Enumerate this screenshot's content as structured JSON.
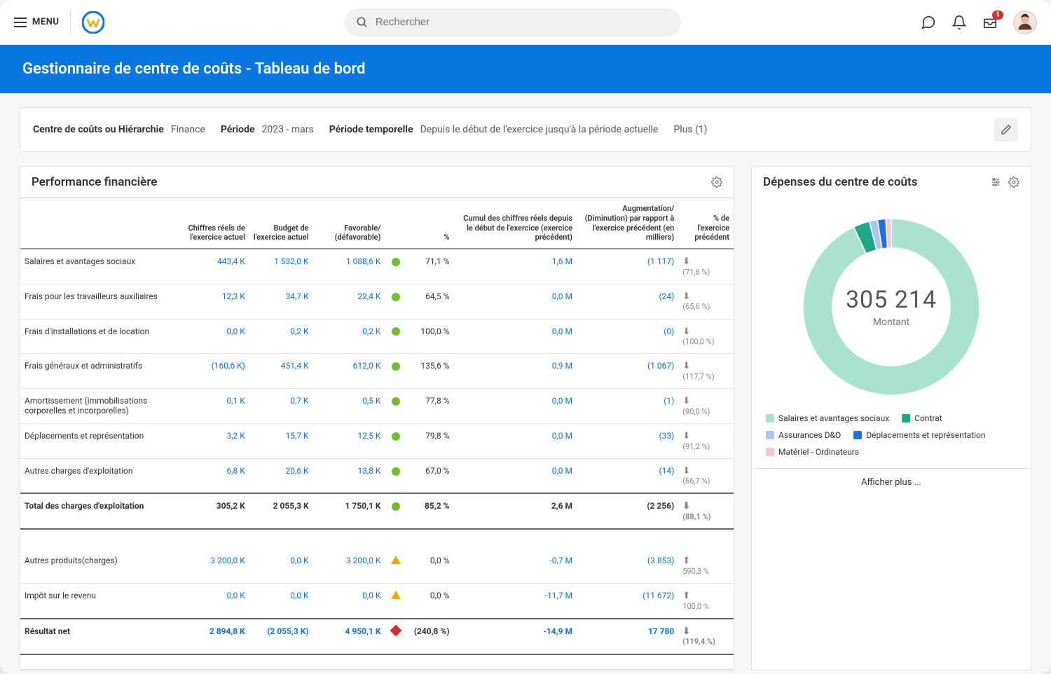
{
  "topbar": {
    "menu_label": "MENU",
    "search_placeholder": "Rechercher",
    "inbox_badge": "1"
  },
  "banner_title": "Gestionnaire de centre de coûts - Tableau de bord",
  "filters": {
    "cc_label": "Centre de coûts ou Hiérarchie",
    "cc_value": "Finance",
    "period_label": "Période",
    "period_value": "2023 - mars",
    "timeframe_label": "Période temporelle",
    "timeframe_value": "Depuis le début de l'exercice jusqu'à la période actuelle",
    "more_label": "Plus (1)"
  },
  "perf": {
    "title": "Performance financière",
    "headers": {
      "name": "",
      "actual": "Chiffres réels de l'exercice actuel",
      "budget": "Budget de l'exercice actuel",
      "fav": "Favorable/ (défavorable)",
      "pct": "%",
      "prior_ytd": "Cumul des chiffres réels depuis le début de l'exercice (exercice précédent)",
      "delta": "Augmentation/ (Diminution) par rapport à l'exercice précédent (en milliers)",
      "prior_pct": "% de l'exercice précédent"
    },
    "rows": [
      {
        "name": "Salaires et avantages sociaux",
        "actual": "443,4 K",
        "budget": "1 532,0 K",
        "fav": "1 088,6 K",
        "ind": "green",
        "pct": "71,1 %",
        "prior": "1,6 M",
        "delta": "(1 117)",
        "arr": "down",
        "ppct": "(71,6 %)"
      },
      {
        "name": "Frais pour les travailleurs auxiliaires",
        "actual": "12,3 K",
        "budget": "34,7 K",
        "fav": "22,4 K",
        "ind": "green",
        "pct": "64,5 %",
        "prior": "0,0 M",
        "delta": "(24)",
        "arr": "down",
        "ppct": "(65,6 %)"
      },
      {
        "name": "Frais d'installations et de location",
        "actual": "0,0 K",
        "budget": "0,2 K",
        "fav": "0,2 K",
        "ind": "green",
        "pct": "100,0 %",
        "prior": "0,0 M",
        "delta": "(0)",
        "arr": "down",
        "ppct": "(100,0 %)"
      },
      {
        "name": "Frais généraux et administratifs",
        "actual": "(160,6 K)",
        "budget": "451,4 K",
        "fav": "612,0 K",
        "ind": "green",
        "pct": "135,6 %",
        "prior": "0,9 M",
        "delta": "(1 067)",
        "arr": "down",
        "ppct": "(117,7 %)"
      },
      {
        "name": "Amortissement (immobilisations corporelles et incorporelles)",
        "actual": "0,1 K",
        "budget": "0,7 K",
        "fav": "0,5 K",
        "ind": "green",
        "pct": "77,8 %",
        "prior": "0,0 M",
        "delta": "(1)",
        "arr": "down",
        "ppct": "(90,0 %)"
      },
      {
        "name": "Déplacements et représentation",
        "actual": "3,2 K",
        "budget": "15,7 K",
        "fav": "12,5 K",
        "ind": "green",
        "pct": "79,8 %",
        "prior": "0,0 M",
        "delta": "(33)",
        "arr": "down",
        "ppct": "(91,2 %)"
      },
      {
        "name": "Autres charges d'exploitation",
        "actual": "6,8 K",
        "budget": "20,6 K",
        "fav": "13,8 K",
        "ind": "green",
        "pct": "67,0 %",
        "prior": "0,0 M",
        "delta": "(14)",
        "arr": "down",
        "ppct": "(66,7 %)"
      }
    ],
    "total": {
      "name": "Total des charges d'exploitation",
      "actual": "305,2 K",
      "budget": "2 055,3 K",
      "fav": "1 750,1 K",
      "ind": "green",
      "pct": "85,2 %",
      "prior": "2,6 M",
      "delta": "(2 256)",
      "arr": "down",
      "ppct": "(88,1 %)"
    },
    "other_rows": [
      {
        "name": "Autres produits(charges)",
        "actual": "3 200,0 K",
        "budget": "0,0 K",
        "fav": "3 200,0 K",
        "ind": "warn",
        "pct": "0,0 %",
        "prior": "-0,7 M",
        "delta": "(3 853)",
        "arr": "up",
        "ppct": "590,3 %"
      },
      {
        "name": "Impôt sur le revenu",
        "actual": "0,0 K",
        "budget": "0,0 K",
        "fav": "0,0 K",
        "ind": "warn",
        "pct": "0,0 %",
        "prior": "-11,7 M",
        "delta": "(11 672)",
        "arr": "up",
        "ppct": "100,0 %"
      }
    ],
    "net": {
      "name": "Résultat net",
      "actual": "2 894,8 K",
      "budget": "(2 055,3 K)",
      "fav": "4 950,1 K",
      "ind": "bad",
      "pct": "(240,8 %)",
      "prior": "-14,9 M",
      "delta": "17 780",
      "arr": "down",
      "ppct": "(119,4 %)"
    }
  },
  "donut": {
    "title": "Dépenses du centre de coûts",
    "center_value": "305 214",
    "center_label": "Montant",
    "legend": [
      {
        "label": "Salaires et avantages sociaux",
        "color": "#a7e3cf"
      },
      {
        "label": "Contrat",
        "color": "#1aa885"
      },
      {
        "label": "Assurances D&O",
        "color": "#a9c7f2"
      },
      {
        "label": "Déplacements et représentation",
        "color": "#1f6fe5"
      },
      {
        "label": "Matériel - Ordinateurs",
        "color": "#f6c4d6"
      }
    ],
    "show_more": "Afficher plus ..."
  },
  "chart_data": {
    "type": "pie",
    "title": "Dépenses du centre de coûts",
    "center_total": 305214,
    "series": [
      {
        "name": "Salaires et avantages sociaux",
        "fraction": 0.93,
        "color": "#a7e3cf"
      },
      {
        "name": "Contrat",
        "fraction": 0.03,
        "color": "#1aa885"
      },
      {
        "name": "Assurances D&O",
        "fraction": 0.015,
        "color": "#a9c7f2"
      },
      {
        "name": "Déplacements et représentation",
        "fraction": 0.015,
        "color": "#1f6fe5"
      },
      {
        "name": "Matériel - Ordinateurs",
        "fraction": 0.01,
        "color": "#f6c4d6"
      }
    ]
  }
}
